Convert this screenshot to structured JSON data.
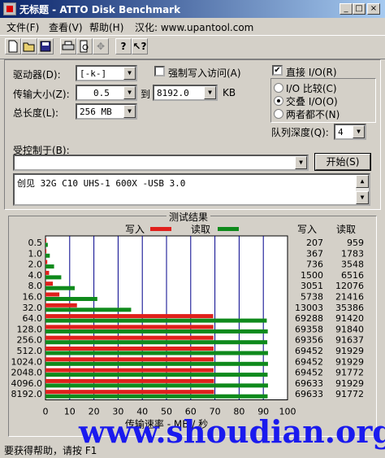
{
  "window": {
    "title": "无标题 - ATTO Disk Benchmark",
    "minimize_label": "_",
    "maximize_label": "□",
    "close_label": "×"
  },
  "menu": {
    "file": "文件(F)",
    "view": "查看(V)",
    "help": "帮助(H)",
    "localized": "汉化: www.upantool.com"
  },
  "toolbar": {
    "new": "new-file-icon",
    "open": "open-folder-icon",
    "save": "save-disk-icon",
    "print": "printer-icon",
    "preview": "print-preview-icon",
    "move": "move-icon",
    "help": "help-icon",
    "context_help": "context-help-icon"
  },
  "settings": {
    "drive_label": "驱动器(D):",
    "drive_value": "[-k-]",
    "force_write_label": "强制写入访问(A)",
    "force_write_checked": false,
    "direct_io_label": "直接 I/O(R)",
    "direct_io_checked": true,
    "transfer_label": "传输大小(Z):",
    "transfer_from": "0.5",
    "to_label": "到",
    "transfer_to": "8192.0",
    "kb_label": "KB",
    "length_label": "总长度(L):",
    "length_value": "256 MB",
    "io_compare": "I/O 比较(C)",
    "io_overlap": "交叠 I/O(O)",
    "io_neither": "两者都不(N)",
    "io_selected": "io_overlap",
    "queue_label": "队列深度(Q):",
    "queue_value": "4",
    "controlled_label": "受控制于(B):",
    "controlled_value": "",
    "start_button": "开始(S)",
    "memo_text": "创见 32G C10 UHS-1 600X -USB 3.0"
  },
  "results": {
    "group_title": "测试结果",
    "legend_write": "写入",
    "legend_read": "读取",
    "col_write": "写入",
    "col_read": "读取",
    "x_axis_label": "传输速率 - MB / 秒"
  },
  "chart_data": {
    "type": "bar",
    "orientation": "horizontal",
    "categories": [
      "0.5",
      "1.0",
      "2.0",
      "4.0",
      "8.0",
      "16.0",
      "32.0",
      "64.0",
      "128.0",
      "256.0",
      "512.0",
      "1024.0",
      "2048.0",
      "4096.0",
      "8192.0"
    ],
    "series": [
      {
        "name": "写入",
        "color": "#e0201c",
        "values_kb_s": [
          207,
          367,
          736,
          1500,
          3051,
          5738,
          13003,
          69288,
          69358,
          69356,
          69452,
          69452,
          69452,
          69633,
          69633
        ]
      },
      {
        "name": "读取",
        "color": "#0f8a1c",
        "values_kb_s": [
          959,
          1783,
          3548,
          6516,
          12076,
          21416,
          35386,
          91420,
          91840,
          91637,
          91929,
          91929,
          91772,
          91929,
          91772
        ]
      }
    ],
    "xlabel": "传输速率 - MB / 秒",
    "xlim": [
      0,
      100
    ],
    "xticks": [
      0,
      10,
      20,
      30,
      40,
      50,
      60,
      70,
      80,
      90,
      100
    ],
    "grid": true
  },
  "status": {
    "text": "要获得帮助，请按 F1"
  },
  "watermark": "www.shoudian.org"
}
